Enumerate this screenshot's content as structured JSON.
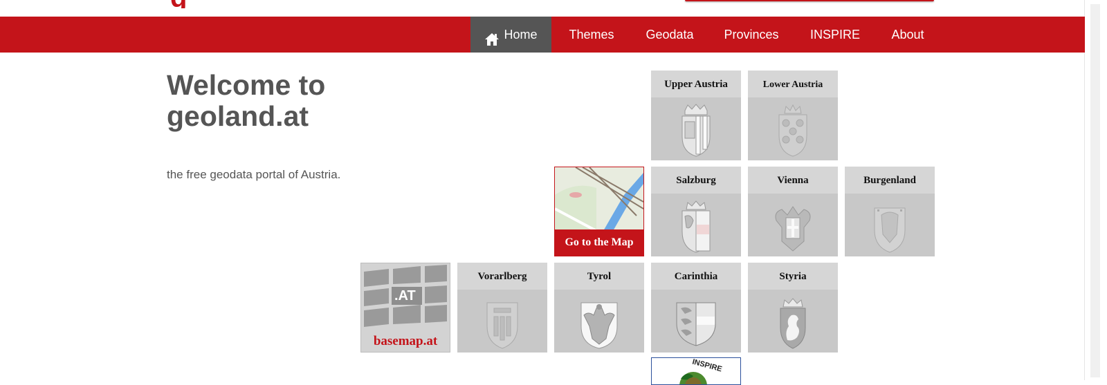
{
  "logo": {
    "fragment": "g"
  },
  "nav": {
    "items": [
      {
        "label": "Home",
        "active": true,
        "icon": "home-icon"
      },
      {
        "label": "Themes",
        "active": false
      },
      {
        "label": "Geodata",
        "active": false
      },
      {
        "label": "Provinces",
        "active": false
      },
      {
        "label": "INSPIRE",
        "active": false
      },
      {
        "label": "About",
        "active": false
      }
    ]
  },
  "intro": {
    "title": "Welcome to geoland.at",
    "tagline": "the free geodata portal of Austria."
  },
  "tiles": {
    "upper_austria": "Upper Austria",
    "lower_austria": "Lower Austria",
    "salzburg": "Salzburg",
    "vienna": "Vienna",
    "burgenland": "Burgenland",
    "vorarlberg": "Vorarlberg",
    "tyrol": "Tyrol",
    "carinthia": "Carinthia",
    "styria": "Styria",
    "go_to_map": "Go to the Map",
    "basemap": "basemap.at",
    "basemap_logo": ".AT",
    "inspire_logo": "INSPIRE"
  },
  "colors": {
    "brand_red": "#c4141a",
    "nav_active": "#555555",
    "tile_bg": "#c8c8c8",
    "tile_header": "#d6d6d6"
  }
}
